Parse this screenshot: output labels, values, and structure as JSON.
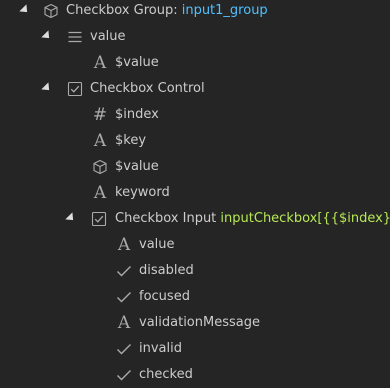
{
  "nodes": [
    {
      "name": "checkbox-group",
      "prefix": "Checkbox Group: ",
      "value": "input1_group",
      "icon": "cube-icon"
    },
    {
      "name": "value",
      "prefix": "value",
      "icon": "list-icon"
    },
    {
      "name": "value-var",
      "prefix": "$value",
      "icon": "type-a-icon"
    },
    {
      "name": "checkbox-control",
      "prefix": "Checkbox Control",
      "icon": "checkbox-icon"
    },
    {
      "name": "index",
      "prefix": "$index",
      "icon": "hash-icon"
    },
    {
      "name": "key",
      "prefix": "$key",
      "icon": "type-a-icon"
    },
    {
      "name": "value-obj",
      "prefix": "$value",
      "icon": "cube-icon"
    },
    {
      "name": "keyword",
      "prefix": "keyword",
      "icon": "type-a-icon"
    },
    {
      "name": "checkbox-input",
      "prefix": "Checkbox Input ",
      "value": "inputCheckbox[{{$index}}]",
      "icon": "checkbox-icon"
    },
    {
      "name": "input-value",
      "prefix": "value",
      "icon": "type-a-icon"
    },
    {
      "name": "disabled",
      "prefix": "disabled",
      "icon": "check-icon"
    },
    {
      "name": "focused",
      "prefix": "focused",
      "icon": "check-icon"
    },
    {
      "name": "validation-message",
      "prefix": "validationMessage",
      "icon": "type-a-icon"
    },
    {
      "name": "invalid",
      "prefix": "invalid",
      "icon": "check-icon"
    },
    {
      "name": "checked",
      "prefix": "checked",
      "icon": "check-icon"
    }
  ],
  "colors": {
    "background": "#252526",
    "text": "#cccccc",
    "icon": "#aaaaaa",
    "accent_blue": "#4fc1ff",
    "accent_green": "#b5e853"
  }
}
